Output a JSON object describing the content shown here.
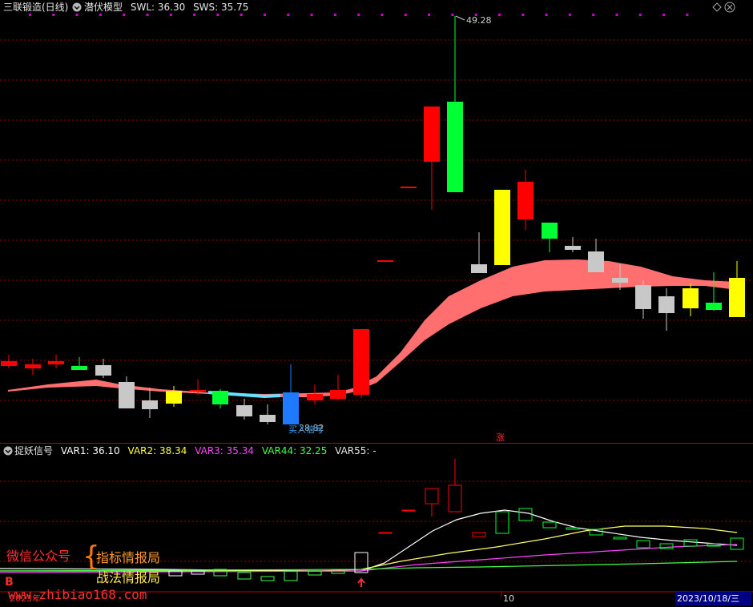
{
  "header": {
    "stock_title": "三联锻造(日线)",
    "indicator_name": "潜伏模型",
    "swl_label": "SWL: 36.30",
    "sws_label": "SWS: 35.75"
  },
  "subheader": {
    "indicator_name": "捉妖信号",
    "var1": "VAR1: 36.10",
    "var2": "VAR2: 38.34",
    "var3": "VAR3: 35.34",
    "var44": "VAR44: 32.25",
    "var55": "VAR55: -"
  },
  "annotations": {
    "high_label": "49.28",
    "low_label": "28.82",
    "buy_text": "买入信号",
    "zhang_label": "涨",
    "b_marker": "B"
  },
  "watermark": {
    "line1_left": "微信公众号",
    "brace": "{",
    "line1_right": "指标情报局",
    "line2_right": "战法情报局",
    "url": "www.zhibiao168.com"
  },
  "xaxis": {
    "year_label": "2023年",
    "tick_10": "10",
    "date_label": "2023/10/18/三"
  },
  "colors": {
    "up": "#ff0000",
    "down_bright": "#00ff33",
    "yellow": "#ffff00",
    "gray": "#c8c8c8",
    "blue": "#1e7bff",
    "band": "#ff6f6f",
    "cyan": "#66e0ff",
    "var1": "#ffffff",
    "var2": "#ffff66",
    "var3": "#ff44ff",
    "var44": "#44ff44",
    "grid": "#8b0000"
  },
  "icons": {
    "menu_icon": "circle-chevron-icon",
    "settings_icon": "diamond-icon",
    "close_icon": "circle-x-icon"
  }
}
